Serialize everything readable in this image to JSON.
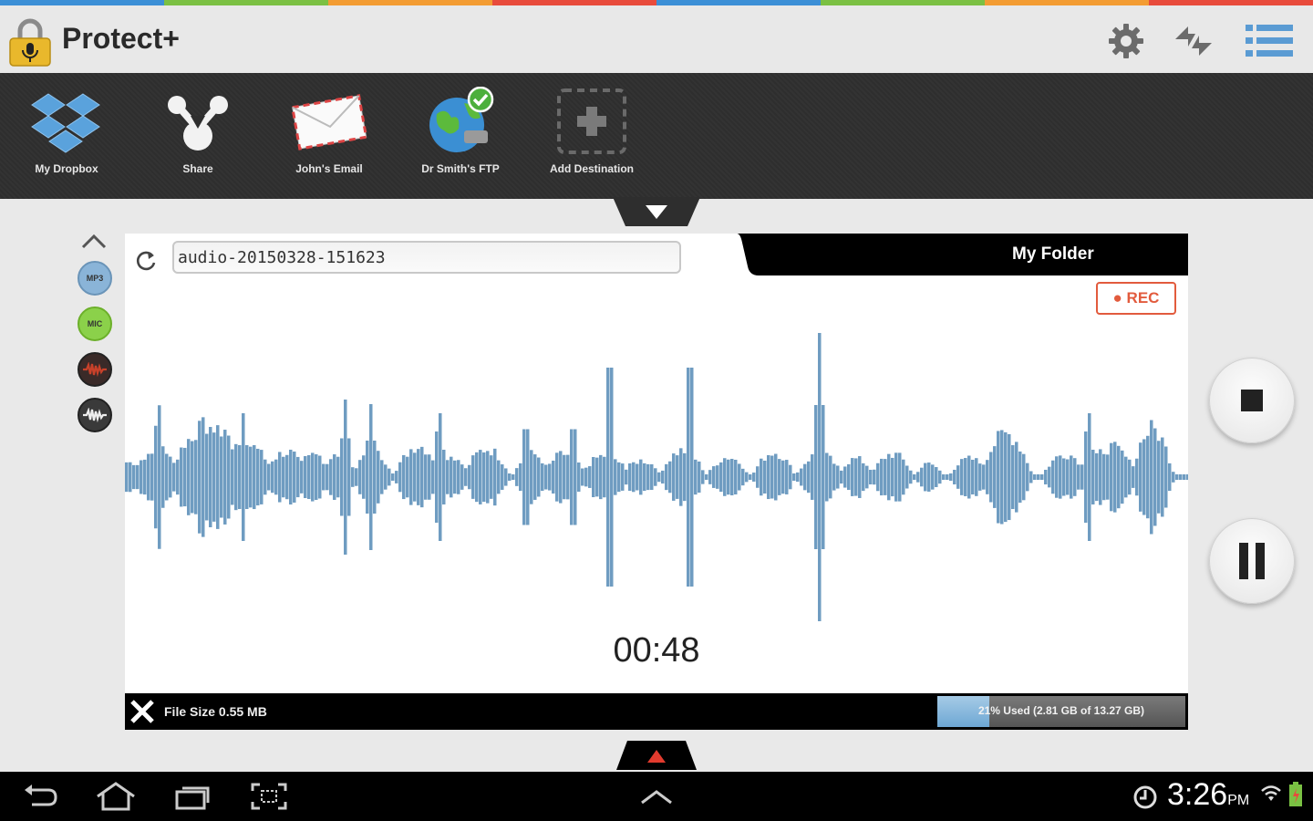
{
  "header": {
    "app_title": "Protect+",
    "stripe_colors": [
      "#3c8fd6",
      "#7bc043",
      "#f39c33",
      "#e84b3c",
      "#3c8fd6",
      "#7bc043",
      "#f39c33",
      "#e84b3c"
    ],
    "actions": [
      {
        "icon": "gear-icon"
      },
      {
        "icon": "sync-icon"
      },
      {
        "icon": "list-menu-icon"
      }
    ]
  },
  "destinations": [
    {
      "label": "My Dropbox",
      "icon": "dropbox-icon"
    },
    {
      "label": "Share",
      "icon": "share-icon"
    },
    {
      "label": "John's Email",
      "icon": "email-icon"
    },
    {
      "label": "Dr Smith's FTP",
      "icon": "ftp-globe-icon"
    },
    {
      "label": "Add Destination",
      "icon": "add-icon"
    }
  ],
  "sidebar": {
    "items": [
      {
        "label": "MP3",
        "color": "#8ab4d8"
      },
      {
        "label": "MIC",
        "color": "#8bd14a"
      },
      {
        "label": "",
        "color": "#3a2a28"
      },
      {
        "label": "",
        "color": "#3a3a3a"
      }
    ]
  },
  "recorder": {
    "filename": "audio-20150328-151623",
    "folder": "My Folder",
    "rec_label": "● REC",
    "timer": "00:48",
    "wave_color": "#6f9cc1"
  },
  "status": {
    "file_size": "File Size 0.55 MB",
    "storage_text": "21% Used (2.81 GB of 13.27 GB)",
    "storage_fraction": 0.21
  },
  "system": {
    "time": "3:26",
    "ampm": "PM"
  }
}
